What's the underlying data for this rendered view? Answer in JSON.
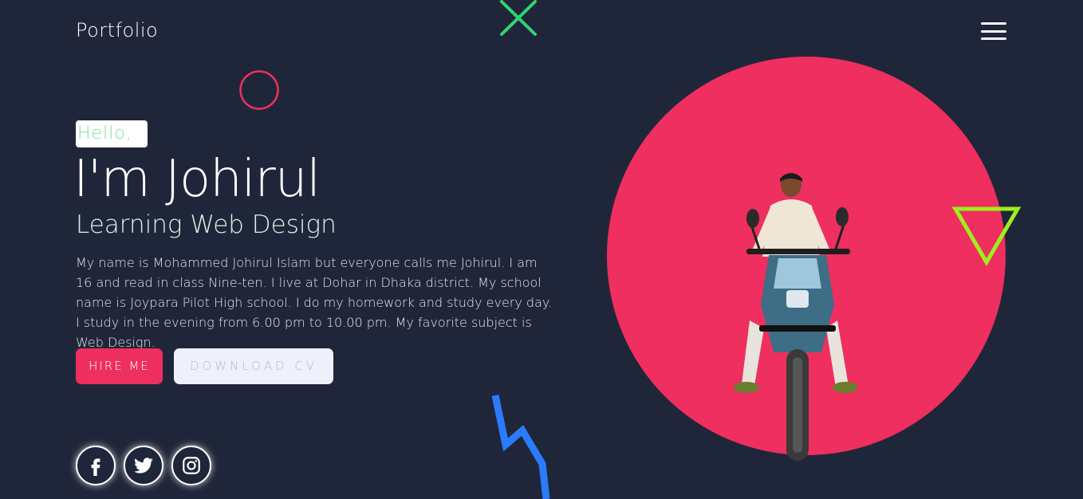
{
  "header": {
    "brand": "Portfolio",
    "menu_icon": "hamburger-icon"
  },
  "hero": {
    "greeting": "Hello,",
    "name": "I'm Johirul",
    "role": "Learning Web Design",
    "bio": "My name is Mohammed Johirul Islam but everyone calls me Johirul. I am 16 and read in class Nine-ten. I live at Dohar in Dhaka district. My school name is Joypara Pilot High school. I do my homework and study every day. I study in the evening from 6.00 pm to 10.00 pm. My favorite subject is Web Design.",
    "buttons": {
      "hire": "HIRE ME",
      "cv": "DOWNLOAD CV"
    }
  },
  "socials": [
    {
      "icon": "facebook-icon"
    },
    {
      "icon": "twitter-icon"
    },
    {
      "icon": "instagram-icon"
    }
  ],
  "colors": {
    "background": "#20263a",
    "accent": "#ee2f5f",
    "greeting_text": "#7ee39a",
    "cross": "#2ed573",
    "triangle": "#9ef01a",
    "bolt": "#2b7bff",
    "ring": "#ee2f5f"
  },
  "decorations": [
    "cross-icon",
    "ring-icon",
    "triangle-icon",
    "lightning-icon"
  ],
  "image": {
    "subject": "person-on-motorcycle"
  }
}
